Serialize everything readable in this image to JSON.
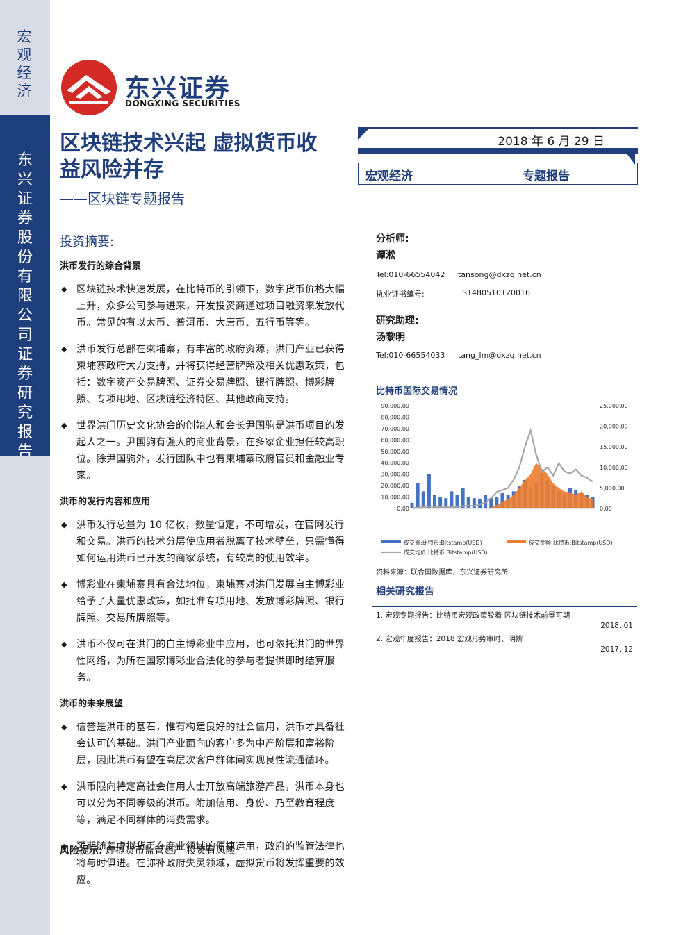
{
  "sidebar": {
    "category": "宏观经济",
    "company_report": "东兴证券股份有限公司证券研究报告"
  },
  "brand": {
    "name_cn": "东兴证券",
    "name_en": "DONGXING SECURITIES",
    "logo_icon": "dongxing-logo-icon",
    "color_red": "#d42a26",
    "color_blue": "#1f3f7c"
  },
  "report": {
    "title": "区块链技术兴起 虚拟货币收益风险并存",
    "subtitle": "——区块链专题报告",
    "date": "2018 年 6 月 29 日",
    "category": "宏观经济",
    "type": "专题报告"
  },
  "summary": {
    "heading": "投资摘要:",
    "sections": [
      {
        "title": "洪币发行的综合背景",
        "bullets": [
          "区块链技术快速发展，在比特币的引领下，数字货币价格大幅上升，众多公司参与进来，开发投资商通过项目融资来发放代币。常见的有以太币、普洱币、大唐币、五行币等等。",
          "洪币发行总部在柬埔寨，有丰富的政府资源，洪门产业已获得柬埔寨政府大力支持，并将获得经营牌照及相关优惠政策，包括：数字资产交易牌照、证券交易牌照、银行牌照、博彩牌照、专项用地、区块链经济特区、其他政商支持。",
          "世界洪门历史文化协会的创始人和会长尹国驹是洪币项目的发起人之一。尹国驹有强大的商业背景，在多家企业担任较高职位。除尹国驹外，发行团队中也有柬埔寨政府官员和金融业专家。"
        ]
      },
      {
        "title": "洪币的发行内容和应用",
        "bullets": [
          "洪币发行总量为 10 亿枚，数量恒定，不可增发，在官网发行和交易。洪币的技术分层使应用者脱离了技术壁垒，只需懂得如何运用洪币已开发的商家系统，有较高的使用效率。",
          "博彩业在柬埔寨具有合法地位，柬埔寨对洪门发展自主博彩业给予了大量优惠政策，如批准专项用地、发放博彩牌照、银行牌照、交易所牌照等。",
          "洪币不仅可在洪门的自主博彩业中应用，也可依托洪门的世界性网络，为所在国家博彩业合法化的参与者提供即时结算服务。"
        ]
      },
      {
        "title": "洪币的未来展望",
        "bullets": [
          "信誉是洪币的基石，惟有构建良好的社会信用，洪币才具备社会认可的基础。洪门产业面向的客户多为中产阶层和富裕阶层，因此洪币有望在高层次客户群体间实现良性流通循环。",
          "洪币限向特定高社会信用人士开放高端旅游产品，洪币本身也可以分为不同等级的洪币。附加信用、身份、乃至教育程度等，满足不同群体的消费需求。",
          "预期随着虚拟货币在商业领域的便捷运用，政府的监管法律也将与时俱进。在弥补政府失灵领域，虚拟货币将发挥重要的效应。"
        ]
      }
    ],
    "risk_label": "风险提示:",
    "risk_text": "虚拟货币监管趋严 投资有风险"
  },
  "analysts": {
    "analyst_label": "分析师:",
    "analyst_name": "谭淞",
    "analyst_tel": "Tel:010-66554042",
    "analyst_email": "tansong@dxzq.net.cn",
    "cert_label": "执业证书编号:",
    "cert_no": "S1480510120016",
    "assistant_label": "研究助理:",
    "assistant_name": "汤黎明",
    "assistant_tel": "Tel:010-66554033",
    "assistant_email": "tang_lm@dxzq.net.cn"
  },
  "chart_data": {
    "type": "area",
    "title": "比特币国际交易情况",
    "y_left_ticks": [
      "90,000.00",
      "80,000.00",
      "70,000.00",
      "60,000.00",
      "50,000.00",
      "40,000.00",
      "30,000.00",
      "20,000.00",
      "10,000.00",
      "0.00"
    ],
    "y_right_ticks": [
      "25,000.00",
      "20,000.00",
      "15,000.00",
      "10,000.00",
      "5,000.00",
      "0.00"
    ],
    "ylim_left": [
      0,
      90000
    ],
    "ylim_right": [
      0,
      25000
    ],
    "series": [
      {
        "name": "成交量:比特币:Bitstamp(USD)",
        "color": "#4472c4",
        "axis": "left",
        "values": [
          5000,
          22000,
          15000,
          30000,
          12000,
          10000,
          9000,
          15000,
          12000,
          18000,
          10000,
          9000,
          8000,
          12000,
          9000,
          10000,
          14000,
          12000,
          15000,
          20000,
          25000,
          18000,
          22000,
          30000,
          25000,
          20000,
          15000,
          12000,
          18000,
          16000,
          14000,
          12000,
          10000
        ]
      },
      {
        "name": "成交金额:比特币:Bitstamp(USD)",
        "color": "#ed7d31",
        "axis": "left",
        "values": [
          0,
          0,
          0,
          0,
          0,
          0,
          0,
          0,
          0,
          0,
          0,
          0,
          0,
          0,
          1000,
          3000,
          6000,
          8000,
          12000,
          18000,
          25000,
          30000,
          40000,
          35000,
          30000,
          22000,
          18000,
          15000,
          14000,
          12000,
          15000,
          10000,
          8000
        ]
      },
      {
        "name": "成交均价:比特币:Bitstamp(USD)",
        "color": "#a6a6a6",
        "axis": "right",
        "values": [
          100,
          200,
          300,
          500,
          400,
          300,
          250,
          300,
          400,
          600,
          700,
          600,
          1000,
          1500,
          2500,
          4000,
          4500,
          5000,
          7000,
          10000,
          15000,
          19000,
          13000,
          9000,
          10000,
          8000,
          11000,
          9000,
          8500,
          9500,
          8000,
          7500,
          6500
        ]
      }
    ],
    "source": "资料来源：联合国数据库，东兴证券研究所"
  },
  "related": {
    "heading": "相关研究报告",
    "items": [
      {
        "text": "1. 宏观专题报告：比特币宏观政策胶着 区块链技术前景可期",
        "date": "2018. 01"
      },
      {
        "text": "2. 宏观年度报告：2018 宏观形势审时、明辨",
        "date": "2017. 12"
      }
    ]
  }
}
